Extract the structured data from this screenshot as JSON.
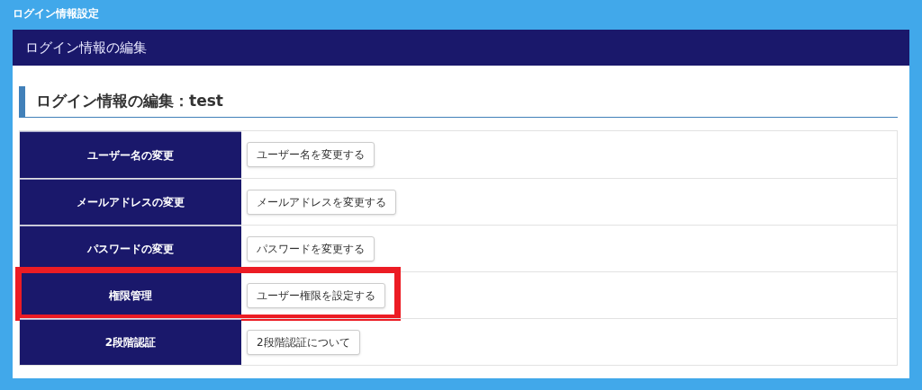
{
  "page_title": "ログイン情報設定",
  "panel": {
    "title": "ログイン情報の編集",
    "heading": "ログイン情報の編集：test"
  },
  "rows": [
    {
      "label": "ユーザー名の変更",
      "button": "ユーザー名を変更する",
      "highlighted": false
    },
    {
      "label": "メールアドレスの変更",
      "button": "メールアドレスを変更する",
      "highlighted": false
    },
    {
      "label": "パスワードの変更",
      "button": "パスワードを変更する",
      "highlighted": false
    },
    {
      "label": "権限管理",
      "button": "ユーザー権限を設定する",
      "highlighted": true
    },
    {
      "label": "2段階認証",
      "button": "2段階認証について",
      "highlighted": false
    }
  ]
}
